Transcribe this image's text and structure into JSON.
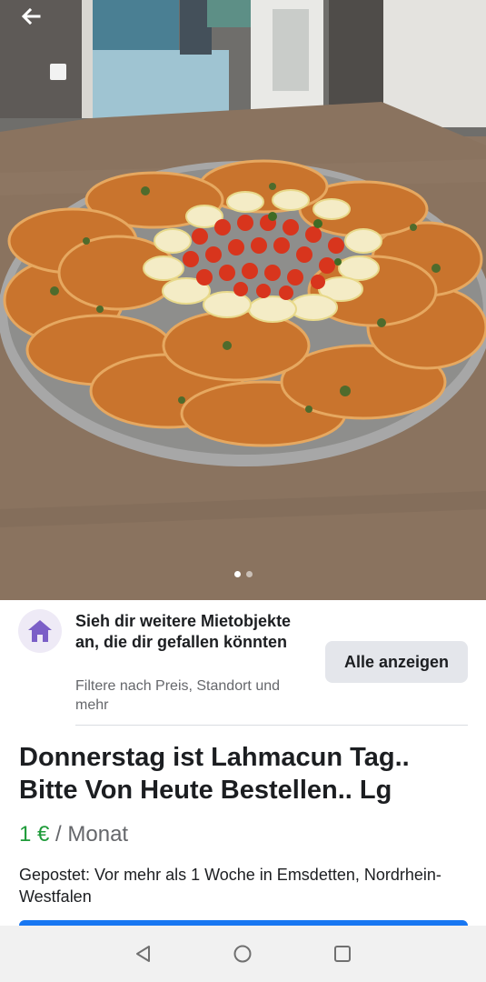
{
  "photo": {
    "alt_subject": "",
    "carousel_count": 2,
    "carousel_active": 0
  },
  "icons": {
    "back": "arrow-left-icon",
    "promo": "house-icon",
    "nav_back": "triangle-back-icon",
    "nav_home": "circle-home-icon",
    "nav_recents": "square-recents-icon"
  },
  "promo": {
    "title": "Sieh dir weitere Mietobjekte an, die dir gefallen könnten",
    "subtitle": "Filtere nach Preis, Standort und mehr",
    "button_label": "Alle anzeigen"
  },
  "listing": {
    "title": "Donnerstag ist Lahmacun Tag.. Bitte Von Heute Bestellen.. Lg",
    "price": "1 €",
    "period": "/ Monat",
    "posted": "Gepostet: Vor mehr als 1 Woche in Emsdetten, Nordrhein-Westfalen"
  },
  "colors": {
    "price_green": "#1f9b3a",
    "promo_accent": "#7b5fc7",
    "cta_blue": "#1877f2"
  }
}
